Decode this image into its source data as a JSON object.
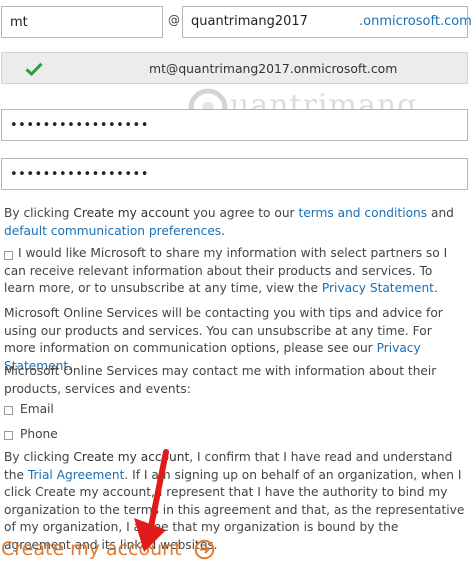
{
  "alias_field": {
    "value": "mt"
  },
  "at_sign": "@",
  "domain_field": {
    "value": "quantrimang2017",
    "suffix": ".onmicrosoft.com"
  },
  "confirmed_address": "mt@quantrimang2017.onmicrosoft.com",
  "password_field": {
    "value": "•••••••••••••••••"
  },
  "confirm_password_field": {
    "value": "•••••••••••••••••"
  },
  "terms": {
    "pre": "By clicking ",
    "bold": "Create my account",
    "mid": " you agree to our ",
    "link1": "terms and conditions",
    "and": " and ",
    "link2": "default communication preferences",
    "end": "."
  },
  "share_consent": {
    "text": "I would like Microsoft to share my information with select partners so I can receive relevant information about their products and services. To learn more, or to unsubscribe at any time, view the ",
    "link": "Privacy Statement",
    "end": "."
  },
  "contact_notice": {
    "text": "Microsoft Online Services will be contacting you with tips and advice for using our products and services. You can unsubscribe at any time. For more information on communication options, please see our ",
    "link": "Privacy Statement",
    "end": "."
  },
  "contact_options_intro": "Microsoft Online Services may contact me with information about their products, services and events:",
  "options": {
    "email": "Email",
    "phone": "Phone"
  },
  "agreement": {
    "pre": "By clicking ",
    "bold": "Create my account",
    "mid": ", I confirm that I have read and understand the ",
    "link": "Trial Agreement",
    "rest": ". If I am signing up on behalf of an organization, when I click Create my account, I represent that I have the authority to bind my organization to the terms in this agreement and that, as the representative of my organization, I agree that my organization is bound by the agreement and its linked websites."
  },
  "create_button": {
    "label": "Create my account"
  },
  "watermark": {
    "text": "uantrimang"
  },
  "colors": {
    "link": "#1a6fb5",
    "accent_orange": "#e07a2f",
    "check_green": "#2d9e3a",
    "arrow_red": "#e01b1b"
  }
}
